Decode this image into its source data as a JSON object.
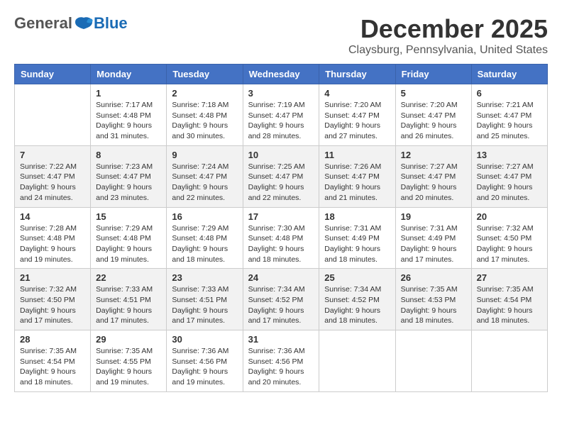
{
  "header": {
    "logo_general": "General",
    "logo_blue": "Blue",
    "month_title": "December 2025",
    "location": "Claysburg, Pennsylvania, United States"
  },
  "calendar": {
    "days_of_week": [
      "Sunday",
      "Monday",
      "Tuesday",
      "Wednesday",
      "Thursday",
      "Friday",
      "Saturday"
    ],
    "weeks": [
      [
        {
          "day": "",
          "info": ""
        },
        {
          "day": "1",
          "info": "Sunrise: 7:17 AM\nSunset: 4:48 PM\nDaylight: 9 hours\nand 31 minutes."
        },
        {
          "day": "2",
          "info": "Sunrise: 7:18 AM\nSunset: 4:48 PM\nDaylight: 9 hours\nand 30 minutes."
        },
        {
          "day": "3",
          "info": "Sunrise: 7:19 AM\nSunset: 4:47 PM\nDaylight: 9 hours\nand 28 minutes."
        },
        {
          "day": "4",
          "info": "Sunrise: 7:20 AM\nSunset: 4:47 PM\nDaylight: 9 hours\nand 27 minutes."
        },
        {
          "day": "5",
          "info": "Sunrise: 7:20 AM\nSunset: 4:47 PM\nDaylight: 9 hours\nand 26 minutes."
        },
        {
          "day": "6",
          "info": "Sunrise: 7:21 AM\nSunset: 4:47 PM\nDaylight: 9 hours\nand 25 minutes."
        }
      ],
      [
        {
          "day": "7",
          "info": "Sunrise: 7:22 AM\nSunset: 4:47 PM\nDaylight: 9 hours\nand 24 minutes."
        },
        {
          "day": "8",
          "info": "Sunrise: 7:23 AM\nSunset: 4:47 PM\nDaylight: 9 hours\nand 23 minutes."
        },
        {
          "day": "9",
          "info": "Sunrise: 7:24 AM\nSunset: 4:47 PM\nDaylight: 9 hours\nand 22 minutes."
        },
        {
          "day": "10",
          "info": "Sunrise: 7:25 AM\nSunset: 4:47 PM\nDaylight: 9 hours\nand 22 minutes."
        },
        {
          "day": "11",
          "info": "Sunrise: 7:26 AM\nSunset: 4:47 PM\nDaylight: 9 hours\nand 21 minutes."
        },
        {
          "day": "12",
          "info": "Sunrise: 7:27 AM\nSunset: 4:47 PM\nDaylight: 9 hours\nand 20 minutes."
        },
        {
          "day": "13",
          "info": "Sunrise: 7:27 AM\nSunset: 4:47 PM\nDaylight: 9 hours\nand 20 minutes."
        }
      ],
      [
        {
          "day": "14",
          "info": "Sunrise: 7:28 AM\nSunset: 4:48 PM\nDaylight: 9 hours\nand 19 minutes."
        },
        {
          "day": "15",
          "info": "Sunrise: 7:29 AM\nSunset: 4:48 PM\nDaylight: 9 hours\nand 19 minutes."
        },
        {
          "day": "16",
          "info": "Sunrise: 7:29 AM\nSunset: 4:48 PM\nDaylight: 9 hours\nand 18 minutes."
        },
        {
          "day": "17",
          "info": "Sunrise: 7:30 AM\nSunset: 4:48 PM\nDaylight: 9 hours\nand 18 minutes."
        },
        {
          "day": "18",
          "info": "Sunrise: 7:31 AM\nSunset: 4:49 PM\nDaylight: 9 hours\nand 18 minutes."
        },
        {
          "day": "19",
          "info": "Sunrise: 7:31 AM\nSunset: 4:49 PM\nDaylight: 9 hours\nand 17 minutes."
        },
        {
          "day": "20",
          "info": "Sunrise: 7:32 AM\nSunset: 4:50 PM\nDaylight: 9 hours\nand 17 minutes."
        }
      ],
      [
        {
          "day": "21",
          "info": "Sunrise: 7:32 AM\nSunset: 4:50 PM\nDaylight: 9 hours\nand 17 minutes."
        },
        {
          "day": "22",
          "info": "Sunrise: 7:33 AM\nSunset: 4:51 PM\nDaylight: 9 hours\nand 17 minutes."
        },
        {
          "day": "23",
          "info": "Sunrise: 7:33 AM\nSunset: 4:51 PM\nDaylight: 9 hours\nand 17 minutes."
        },
        {
          "day": "24",
          "info": "Sunrise: 7:34 AM\nSunset: 4:52 PM\nDaylight: 9 hours\nand 17 minutes."
        },
        {
          "day": "25",
          "info": "Sunrise: 7:34 AM\nSunset: 4:52 PM\nDaylight: 9 hours\nand 18 minutes."
        },
        {
          "day": "26",
          "info": "Sunrise: 7:35 AM\nSunset: 4:53 PM\nDaylight: 9 hours\nand 18 minutes."
        },
        {
          "day": "27",
          "info": "Sunrise: 7:35 AM\nSunset: 4:54 PM\nDaylight: 9 hours\nand 18 minutes."
        }
      ],
      [
        {
          "day": "28",
          "info": "Sunrise: 7:35 AM\nSunset: 4:54 PM\nDaylight: 9 hours\nand 18 minutes."
        },
        {
          "day": "29",
          "info": "Sunrise: 7:35 AM\nSunset: 4:55 PM\nDaylight: 9 hours\nand 19 minutes."
        },
        {
          "day": "30",
          "info": "Sunrise: 7:36 AM\nSunset: 4:56 PM\nDaylight: 9 hours\nand 19 minutes."
        },
        {
          "day": "31",
          "info": "Sunrise: 7:36 AM\nSunset: 4:56 PM\nDaylight: 9 hours\nand 20 minutes."
        },
        {
          "day": "",
          "info": ""
        },
        {
          "day": "",
          "info": ""
        },
        {
          "day": "",
          "info": ""
        }
      ]
    ]
  }
}
